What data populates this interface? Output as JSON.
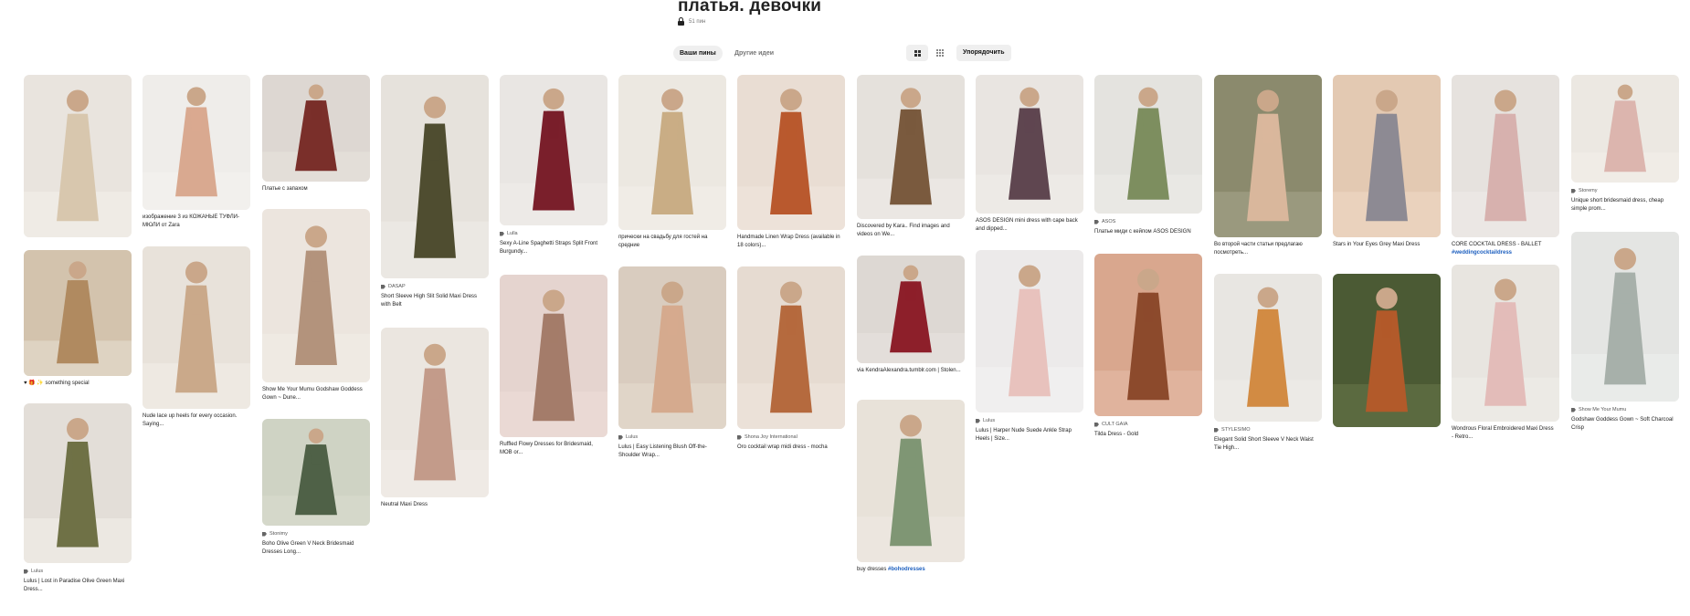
{
  "board": {
    "title": "платья. девочки",
    "pin_count": "51 пин"
  },
  "tabs": [
    {
      "label": "Ваши пины",
      "active": true
    },
    {
      "label": "Другие идеи",
      "active": false
    }
  ],
  "toolbar": {
    "organize_label": "Упорядочить",
    "view_icons": [
      "grid-icon",
      "dense-grid-icon"
    ]
  },
  "columns": [
    [
      {
        "colors": [
          "#e9e4de",
          "#d8c7ae",
          "#f4f0ea"
        ],
        "source": "",
        "caption": ""
      },
      {
        "colors": [
          "#d3c3ad",
          "#b08a60",
          "#e6ddd0"
        ],
        "source": "",
        "caption": "♥ 🎁 ✨ something special"
      },
      {
        "colors": [
          "#e3ded8",
          "#6f7146",
          "#f1eeea"
        ],
        "source": "Lulus",
        "caption": "Lulus | Lost in Paradise Olive Green Maxi Dress..."
      }
    ],
    [
      {
        "colors": [
          "#efedea",
          "#d9a990",
          "#f4f2ef"
        ],
        "source": "",
        "caption": "изображение 3 из КОЖАНЫЕ ТУФЛИ-МЮЛИ от Zara"
      },
      {
        "colors": [
          "#e8e2da",
          "#caa98a",
          "#f2eee8"
        ],
        "source": "",
        "caption": "Nude lace up heels for every occasion. Saying..."
      }
    ],
    [
      {
        "colors": [
          "#ddd7d2",
          "#7a2f2a",
          "#e7e2dc"
        ],
        "source": "",
        "caption": "Платье с запахом"
      },
      {
        "colors": [
          "#ece5de",
          "#b3937c",
          "#f1ece6"
        ],
        "source": "",
        "caption": "Show Me Your Mumu Godshaw Goddess Gown ~ Dune..."
      },
      {
        "colors": [
          "#cfd3c4",
          "#4f6147",
          "#d9dccf"
        ],
        "source": "Stonimy",
        "caption": "Boho Olive Green V Neck Bridesmaid Dresses Long..."
      }
    ],
    [
      {
        "colors": [
          "#e6e2dc",
          "#4f4d30",
          "#efece8"
        ],
        "source": "DASAP",
        "caption": "Short Sleeve High Slit Solid Maxi Dress with Belt"
      },
      {
        "colors": [
          "#ebe6e0",
          "#c39b8a",
          "#f1ede8"
        ],
        "source": "",
        "caption": "Neutral Maxi Dress"
      }
    ],
    [
      {
        "colors": [
          "#e9e6e3",
          "#7a1f2b",
          "#f0edea"
        ],
        "source": "Lulla",
        "caption": "Sexy A-Line Spaghetti Straps Split Front Burgundy..."
      },
      {
        "colors": [
          "#e5d4cf",
          "#a47c6a",
          "#ecdcd7"
        ],
        "source": "",
        "caption": "Ruffled Flowy Dresses for Bridesmaid, MOB or..."
      }
    ],
    [
      {
        "colors": [
          "#ece8e1",
          "#c9ad85",
          "#f3efe9"
        ],
        "source": "",
        "caption": "прически на свадьбу для гостей на средние"
      },
      {
        "colors": [
          "#d9ccbf",
          "#d5aa8e",
          "#e4dace"
        ],
        "source": "Lulus",
        "caption": "Lulus | Easy Listening Blush Off-the-Shoulder Wrap..."
      }
    ],
    [
      {
        "colors": [
          "#e9ddd3",
          "#b9592e",
          "#f0e6dd"
        ],
        "source": "",
        "caption": "Handmade Linen Wrap Dress (available in 18 colors)..."
      },
      {
        "colors": [
          "#e6dbd1",
          "#b56a3e",
          "#eee5dc"
        ],
        "source": "Shona Joy International",
        "caption": "Oro cocktail wrap midi dress - mocha"
      }
    ],
    [
      {
        "colors": [
          "#e5e1dc",
          "#7a5a3e",
          "#eeebe7"
        ],
        "source": "",
        "caption": "Discovered by Kara.. Find images and videos on We..."
      },
      {
        "colors": [
          "#ddd8d3",
          "#8d1f2a",
          "#e7e3df"
        ],
        "source": "",
        "caption": "via KendraAlexandra.tumblr.com | Stolen..."
      },
      {
        "colors": [
          "#e8e2d9",
          "#7f9674",
          "#efeae3"
        ],
        "source": "",
        "caption": "buy dresses",
        "hashtag": "#bohodresses"
      }
    ],
    [
      {
        "colors": [
          "#e9e5e1",
          "#5f4650",
          "#f0ede9"
        ],
        "source": "",
        "caption": "ASOS DESIGN mini dress with cape back and dipped..."
      },
      {
        "colors": [
          "#eceaea",
          "#e8c2bd",
          "#f3f1f1"
        ],
        "source": "Lulus",
        "caption": "Lulus | Harper Nude Suede Ankle Strap Heels | Size..."
      }
    ],
    [
      {
        "colors": [
          "#e4e3df",
          "#7d8e5f",
          "#ecebe8"
        ],
        "source": "ASOS",
        "caption": "Платье миди с кейпом ASOS DESIGN"
      },
      {
        "colors": [
          "#d9a78e",
          "#8c4a2c",
          "#e5bba6"
        ],
        "source": "CULT GAIA",
        "caption": "Tilda Dress - Gold"
      }
    ],
    [
      {
        "colors": [
          "#8b8a6d",
          "#d9b79c",
          "#a5a38a"
        ],
        "source": "",
        "caption": "Во второй части статьи предлагаю посмотреть..."
      },
      {
        "colors": [
          "#e8e6e2",
          "#d28b43",
          "#efedea"
        ],
        "source": "STYLESIMO",
        "caption": "Elegant Solid Short Sleeve V Neck Waist Tie High..."
      }
    ],
    [
      {
        "colors": [
          "#e3c9b2",
          "#8d8a93",
          "#eed8c5"
        ],
        "source": "",
        "caption": "Stars in Your Eyes Grey Maxi Dress"
      },
      {
        "colors": [
          "#4b5a34",
          "#b25a2a",
          "#65744a"
        ],
        "source": "",
        "caption": ""
      }
    ],
    [
      {
        "colors": [
          "#e6e2de",
          "#d7b1ae",
          "#eeebe8"
        ],
        "source": "",
        "caption": "CORE COCKTAIL DRESS - BALLET",
        "hashtag": "#weddingcocktaildress"
      },
      {
        "colors": [
          "#e8e5e0",
          "#e3bcb9",
          "#efece8"
        ],
        "source": "",
        "caption": "Wondrous Floral Embroidered Maxi Dress - Retro..."
      }
    ],
    [
      {
        "colors": [
          "#ece8e2",
          "#dcb5ae",
          "#f3efea"
        ],
        "source": "Storemy",
        "caption": "Unique short bridesmaid dress, cheap simple prom..."
      },
      {
        "colors": [
          "#e4e5e3",
          "#a7b0aa",
          "#eceeec"
        ],
        "source": "Show Me Your Mumu",
        "caption": "Godshaw Goddess Gown ~ Soft Charcoal Crisp"
      }
    ]
  ]
}
